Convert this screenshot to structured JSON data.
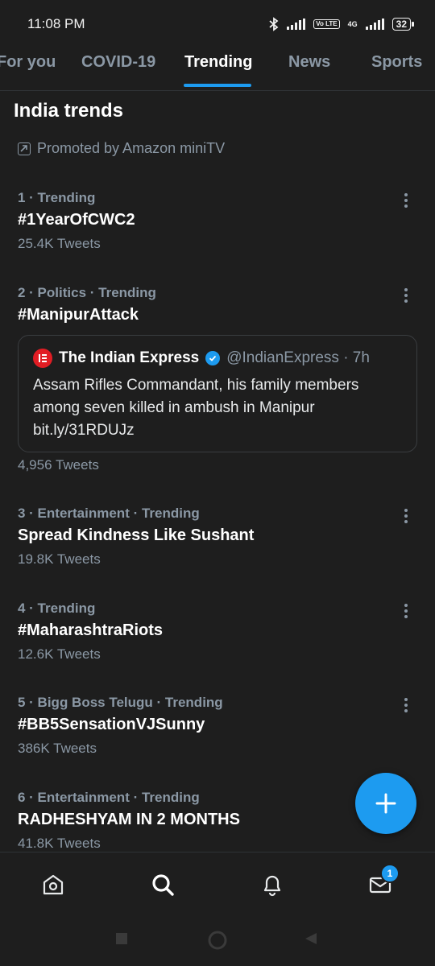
{
  "status_bar": {
    "time": "11:08 PM",
    "volte": "Vo LTE",
    "network": "4G",
    "battery": "32"
  },
  "tabs": [
    "For you",
    "COVID-19",
    "Trending",
    "News",
    "Sports"
  ],
  "active_tab": "Trending",
  "section_title": "India trends",
  "promoted": {
    "text": "Promoted by Amazon miniTV",
    "icon": "promoted-icon"
  },
  "trends": [
    {
      "meta": "1 · Trending",
      "name": "#1YearOfCWC2",
      "count": "25.4K Tweets"
    },
    {
      "meta": "2 · Politics · Trending",
      "name": "#ManipurAttack",
      "count": "4,956 Tweets"
    },
    {
      "meta": "3 · Entertainment · Trending",
      "name": "Spread Kindness Like Sushant",
      "count": "19.8K Tweets"
    },
    {
      "meta": "4 · Trending",
      "name": "#MaharashtraRiots",
      "count": "12.6K Tweets"
    },
    {
      "meta": "5 · Bigg Boss Telugu · Trending",
      "name": "#BB5SensationVJSunny",
      "count": "386K Tweets"
    },
    {
      "meta": "6 · Entertainment · Trending",
      "name": "RADHESHYAM IN 2 MONTHS",
      "count": "41.8K Tweets"
    }
  ],
  "news_card": {
    "source": "The Indian Express",
    "handle": "@IndianExpress · 7h",
    "text_line1": "Assam Rifles Commandant, his family members",
    "text_line2": "among seven killed in ambush in Manipur",
    "text_line3": "bit.ly/31RDUJz"
  },
  "bottom_nav": {
    "icons": [
      "home-icon",
      "search-icon",
      "notifications-icon",
      "messages-icon"
    ],
    "messages_badge": "1"
  },
  "colors": {
    "background": "#1e1e1e",
    "accent": "#1d9bf0",
    "secondary_text": "#8b98a5",
    "primary_text": "#ffffff"
  }
}
